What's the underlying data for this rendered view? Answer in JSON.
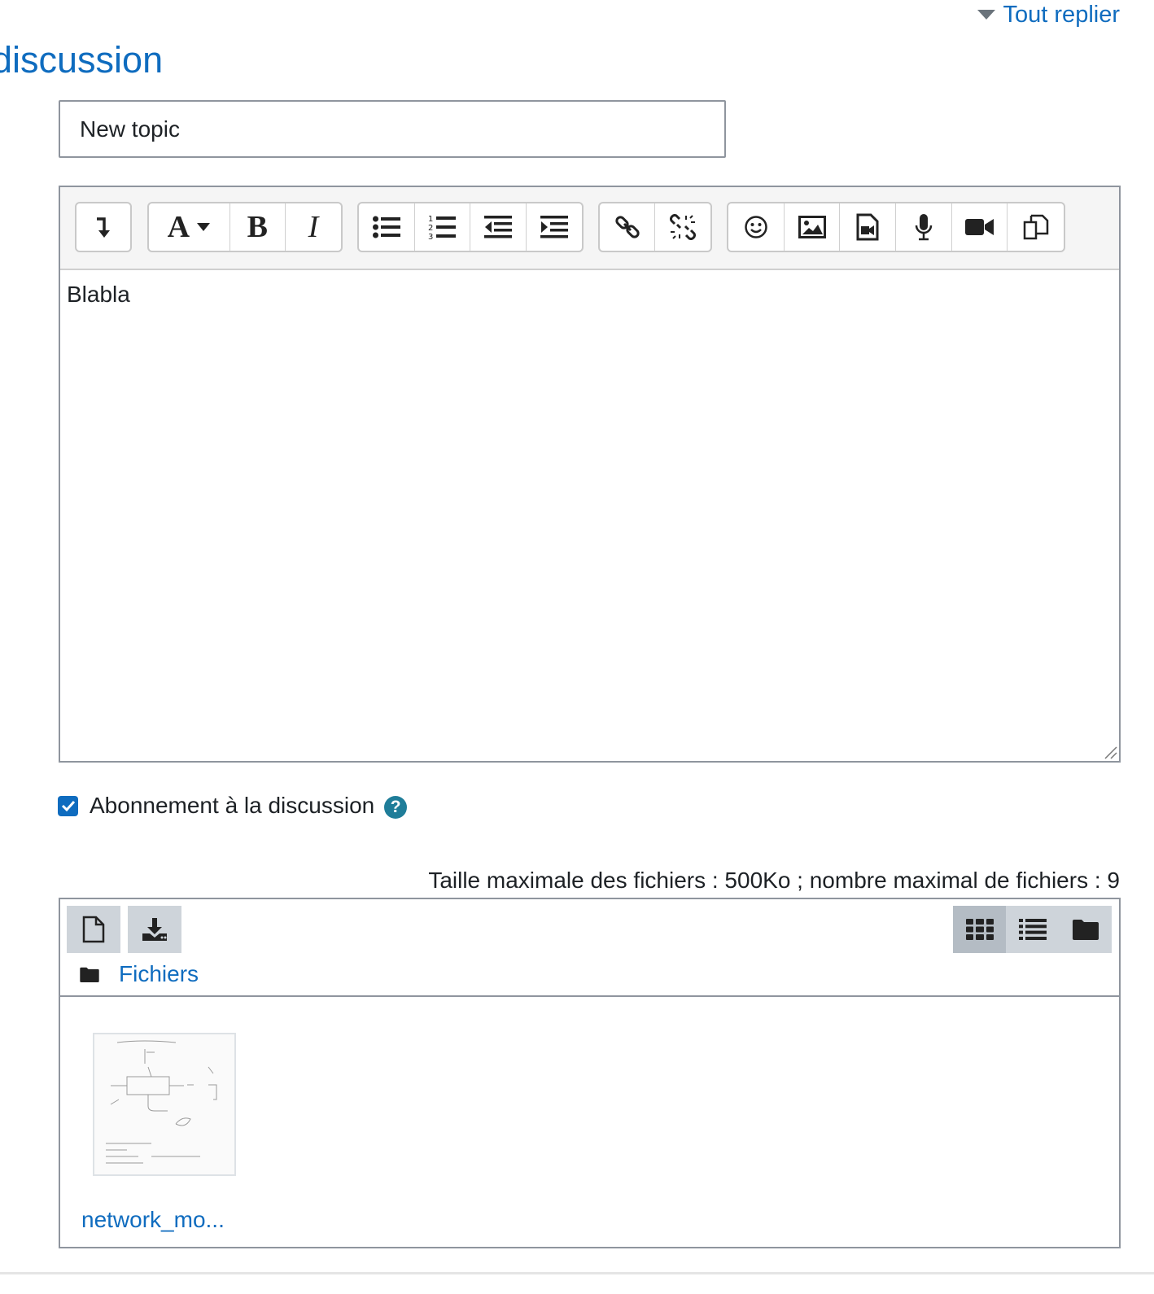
{
  "header": {
    "collapse_all_label": "Tout replier",
    "section_title": "discussion"
  },
  "subject": {
    "value": "New topic"
  },
  "editor": {
    "content": "Blabla",
    "toolbar": {
      "groups": [
        [
          "show-more-buttons"
        ],
        [
          "paragraph-styles",
          "bold",
          "italic"
        ],
        [
          "unordered-list",
          "ordered-list",
          "outdent",
          "indent"
        ],
        [
          "link",
          "unlink"
        ],
        [
          "emoji",
          "image",
          "media",
          "record-audio",
          "record-video",
          "manage-files"
        ]
      ],
      "bold_glyph": "B",
      "italic_glyph": "I",
      "paragraph_glyph": "A"
    }
  },
  "subscribe": {
    "label": "Abonnement à la discussion",
    "checked": true,
    "help_glyph": "?"
  },
  "files": {
    "limits": "Taille maximale des fichiers : 500Ko ; nombre maximal de fichiers : 9",
    "path_label": "Fichiers",
    "items": [
      {
        "name": "network_mo..."
      }
    ],
    "current_view": "icons"
  },
  "colors": {
    "link": "#0f6cbf",
    "checkbox": "#0f6cbf",
    "help": "#1f7d99"
  }
}
